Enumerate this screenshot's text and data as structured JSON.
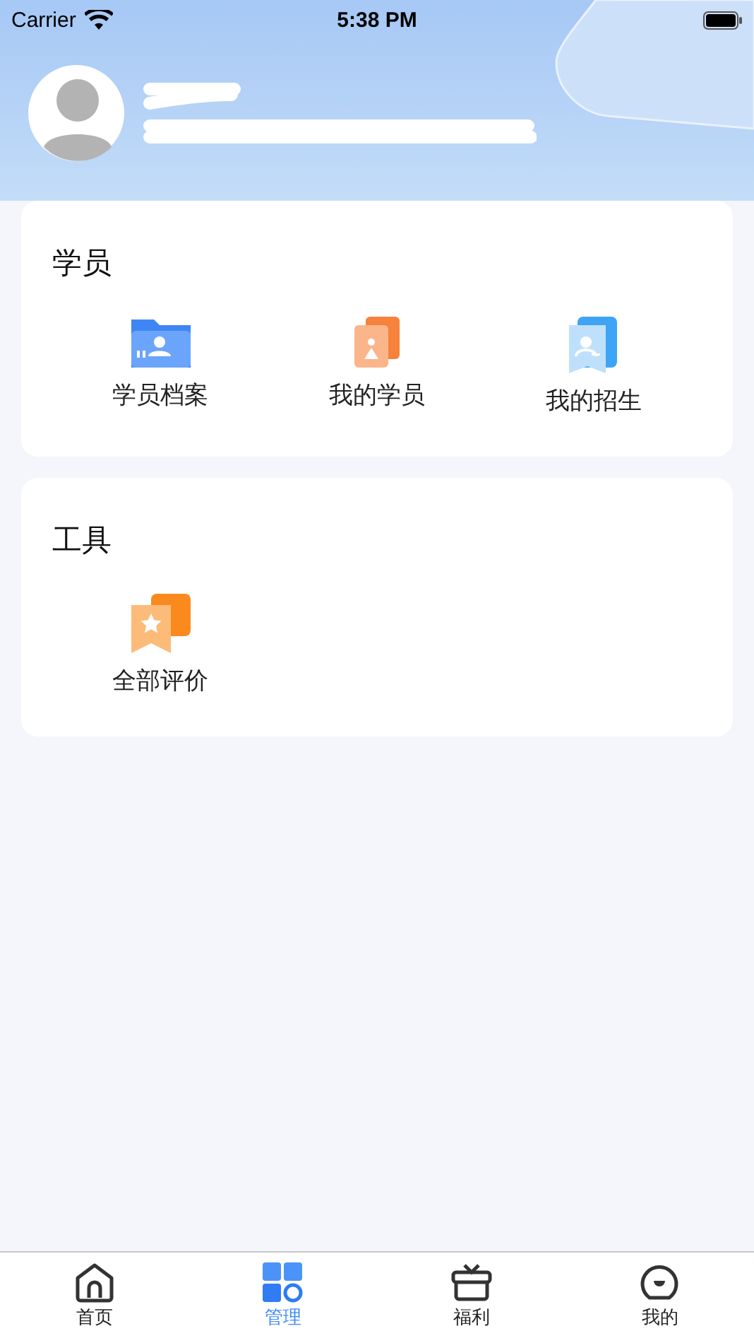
{
  "status_bar": {
    "carrier": "Carrier",
    "time": "5:38 PM"
  },
  "sections": [
    {
      "title": "学员",
      "items": [
        {
          "label": "学员档案",
          "kind": "folder"
        },
        {
          "label": "我的学员",
          "kind": "document"
        },
        {
          "label": "我的招生",
          "kind": "contact"
        }
      ]
    },
    {
      "title": "工具",
      "items": [
        {
          "label": "全部评价",
          "kind": "review"
        }
      ]
    }
  ],
  "tab_bar": [
    {
      "label": "首页",
      "kind": "home",
      "selected": false
    },
    {
      "label": "管理",
      "kind": "grid",
      "selected": true
    },
    {
      "label": "福利",
      "kind": "gift",
      "selected": false
    },
    {
      "label": "我的",
      "kind": "face",
      "selected": false
    }
  ]
}
